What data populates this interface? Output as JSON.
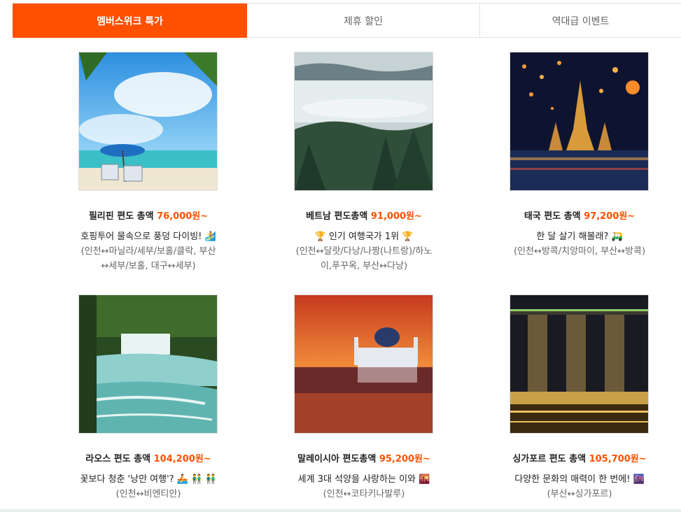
{
  "tabs": [
    {
      "label": "멤버스위크 특가"
    },
    {
      "label": "제휴 할인"
    },
    {
      "label": "역대급 이벤트"
    }
  ],
  "cards": [
    {
      "title": "필리핀 편도 총액 ",
      "price": "76,000원~",
      "line1": "호핑투어 물속으로 풍덩 다이빙! 🏄",
      "route": "(인천↔마닐라/세부/보홀/클락, 부산↔세부/보홀, 대구↔세부)"
    },
    {
      "title": "베트남 편도총액 ",
      "price": "91,000원~",
      "line1": "🏆 인기 여행국가 1위 🏆",
      "route": "(인천↔달랏/다낭/나짱(나트랑)/하노이,푸꾸옥, 부산↔다낭)"
    },
    {
      "title": "태국 편도 총액 ",
      "price": "97,200원~",
      "line1": "한 달 살기 해볼래? 🛺",
      "route": "(인천↔방콕/치앙마이, 부산↔방콕)"
    },
    {
      "title": "라오스 편도 총액 ",
      "price": "104,200원~",
      "line1": "꽃보다 청춘 '낭만 여행'? 🚣 👬 👬",
      "route": "(인천↔비엔티안)"
    },
    {
      "title": "말레이시아 편도총액 ",
      "price": "95,200원~",
      "line1": "세계 3대 석양을 사랑하는 이와 🌇",
      "route": "(인천↔코타키나발루)"
    },
    {
      "title": "싱가포르 편도 총액 ",
      "price": "105,700원~",
      "line1": "다양한 문화의 매력이 한 번에! 🌆",
      "route": "(부산↔싱가포르)"
    }
  ],
  "colors": {
    "accent": "#ff5000",
    "tab_active_bg": "#ff5000"
  }
}
